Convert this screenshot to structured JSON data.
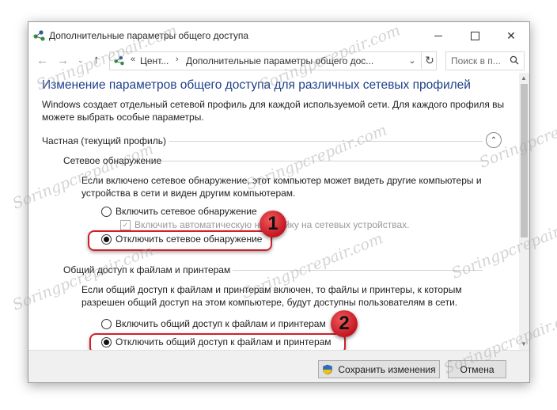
{
  "window": {
    "title": "Дополнительные параметры общего доступа",
    "controls": {
      "minimize": "—",
      "maximize": "☐",
      "close": "✕"
    }
  },
  "nav": {
    "back": "←",
    "forward": "→",
    "up": "↑",
    "recent": "⌄",
    "crumb_sep": "«",
    "crumb_1": "Цент...",
    "crumb_sep2": "›",
    "crumb_2": "Дополнительные параметры общего дос...",
    "dropdown": "⌄",
    "refresh": "↻",
    "search_placeholder": "Поиск в п..."
  },
  "main": {
    "heading": "Изменение параметров общего доступа для различных сетевых профилей",
    "intro": "Windows создает отдельный сетевой профиль для каждой используемой сети. Для каждого профиля вы можете выбрать особые параметры.",
    "profile_label": "Частная (текущий профиль)",
    "collapse_glyph": "⌃",
    "discovery": {
      "title": "Сетевое обнаружение",
      "description": "Если включено сетевое обнаружение, этот компьютер может видеть другие компьютеры и устройства в сети и виден другим компьютерам.",
      "option_on": "Включить сетевое обнаружение",
      "auto_setup": "Включить автоматическую настройку на сетевых устройствах.",
      "option_off": "Отключить сетевое обнаружение",
      "selected": "off"
    },
    "sharing": {
      "title": "Общий доступ к файлам и принтерам",
      "description": "Если общий доступ к файлам и принтерам включен, то файлы и принтеры, к которым разрешен общий доступ на этом компьютере, будут доступны пользователям в сети.",
      "option_on": "Включить общий доступ к файлам и принтерам",
      "option_off": "Отключить общий доступ к файлам и принтерам",
      "selected": "off"
    }
  },
  "annotations": {
    "badge_1": "1",
    "badge_2": "2",
    "highlight_color": "#d0202c"
  },
  "footer": {
    "save_label": "Сохранить изменения",
    "cancel_label": "Отмена"
  },
  "watermark": "Soringpcrepair.com",
  "colors": {
    "heading": "#1e3f8a",
    "app_icon_green": "#2e9b3e",
    "app_icon_blue": "#1f5fa8"
  }
}
